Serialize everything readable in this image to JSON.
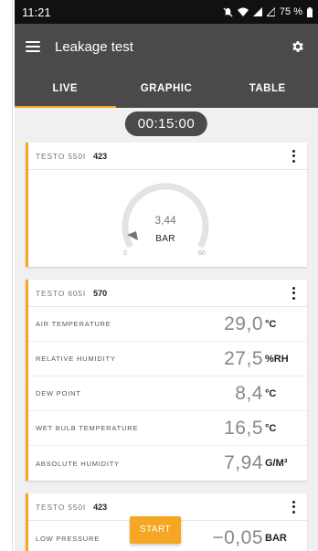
{
  "status_bar": {
    "time": "11:21",
    "battery": "75 %"
  },
  "app_bar": {
    "title": "Leakage test"
  },
  "tabs": [
    {
      "label": "LIVE",
      "active": true
    },
    {
      "label": "GRAPHIC",
      "active": false
    },
    {
      "label": "TABLE",
      "active": false
    }
  ],
  "timer": "00:15:00",
  "gauge_card": {
    "model": "TESTO 550I",
    "serial": "423",
    "value": "3,44",
    "unit": "BAR",
    "min": "0",
    "max": "60"
  },
  "humidity_card": {
    "model": "TESTO 605I",
    "serial": "570",
    "rows": [
      {
        "label": "AIR TEMPERATURE",
        "value": "29,0",
        "unit": "°C"
      },
      {
        "label": "RELATIVE HUMIDITY",
        "value": "27,5",
        "unit": "%RH"
      },
      {
        "label": "DEW POINT",
        "value": "8,4",
        "unit": "°C"
      },
      {
        "label": "WET BULB TEMPERATURE",
        "value": "16,5",
        "unit": "°C"
      },
      {
        "label": "ABSOLUTE HUMIDITY",
        "value": "7,94",
        "unit": "G/M³"
      }
    ]
  },
  "third_card": {
    "model": "TESTO 550I",
    "serial": "423",
    "row": {
      "label": "LOW PRESSURE",
      "value": "−0,05",
      "unit": "BAR"
    }
  },
  "start_button": "START",
  "colors": {
    "accent": "#f5a623",
    "app_bar": "#4a4a4a",
    "status_bar": "#111111"
  },
  "icons": [
    "menu-icon",
    "gear-icon",
    "kebab-menu-icon",
    "wifi-icon",
    "signal-icon",
    "battery-icon",
    "mute-icon"
  ]
}
